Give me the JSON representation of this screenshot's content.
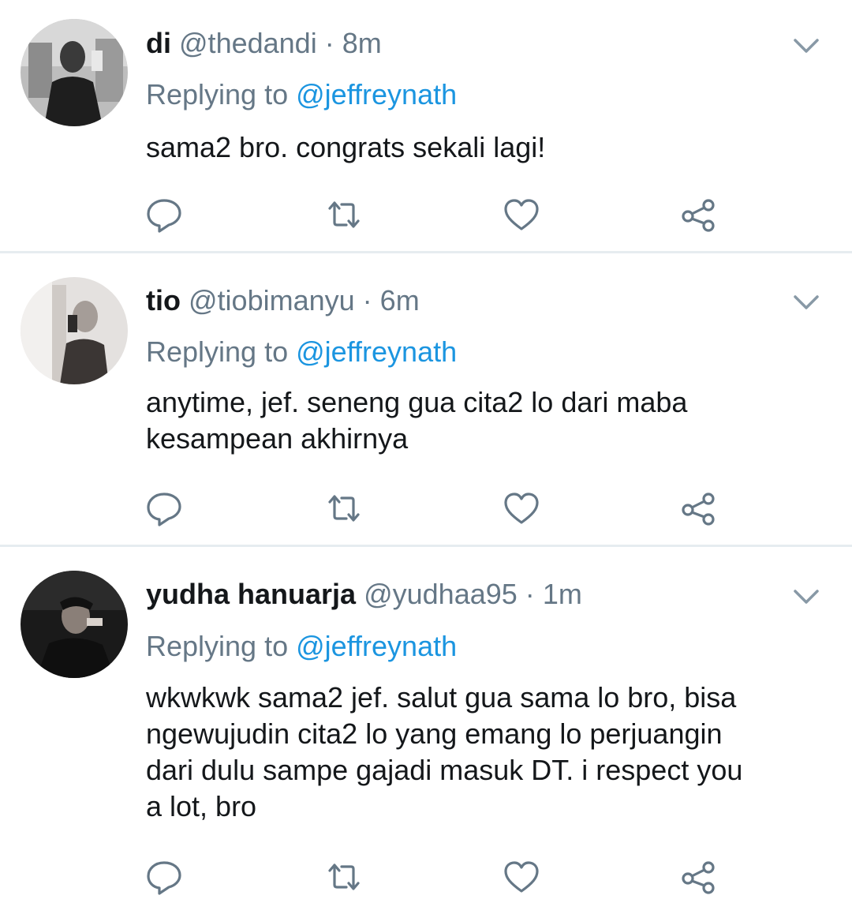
{
  "tweets": [
    {
      "name": "di",
      "handle": "@thedandi",
      "separator": "·",
      "time": "8m",
      "replying_prefix": "Replying to",
      "replying_to": "@jeffreynath",
      "text": "sama2 bro. congrats sekali lagi!",
      "avatar_tone": "grayscale"
    },
    {
      "name": "tio",
      "handle": "@tiobimanyu",
      "separator": "·",
      "time": "6m",
      "replying_prefix": "Replying to",
      "replying_to": "@jeffreynath",
      "text": "anytime, jef. seneng gua cita2 lo dari maba\nkesampean akhirnya",
      "avatar_tone": "light"
    },
    {
      "name": "yudha hanuarja",
      "handle": "@yudhaa95",
      "separator": "·",
      "time": "1m",
      "replying_prefix": "Replying to",
      "replying_to": "@jeffreynath",
      "text": "wkwkwk sama2 jef. salut gua sama lo bro, bisa\nngewujudin cita2 lo yang emang lo perjuangin\ndari dulu sampe gajadi masuk DT. i respect you\na lot, bro",
      "avatar_tone": "dark"
    }
  ],
  "icons": {
    "reply": "reply-icon",
    "retweet": "retweet-icon",
    "like": "heart-icon",
    "share": "share-icon",
    "more": "chevron-down-icon"
  },
  "colors": {
    "text": "#14171a",
    "secondary": "#657786",
    "mention": "#1b95e0",
    "divider": "#e6ecf0"
  }
}
